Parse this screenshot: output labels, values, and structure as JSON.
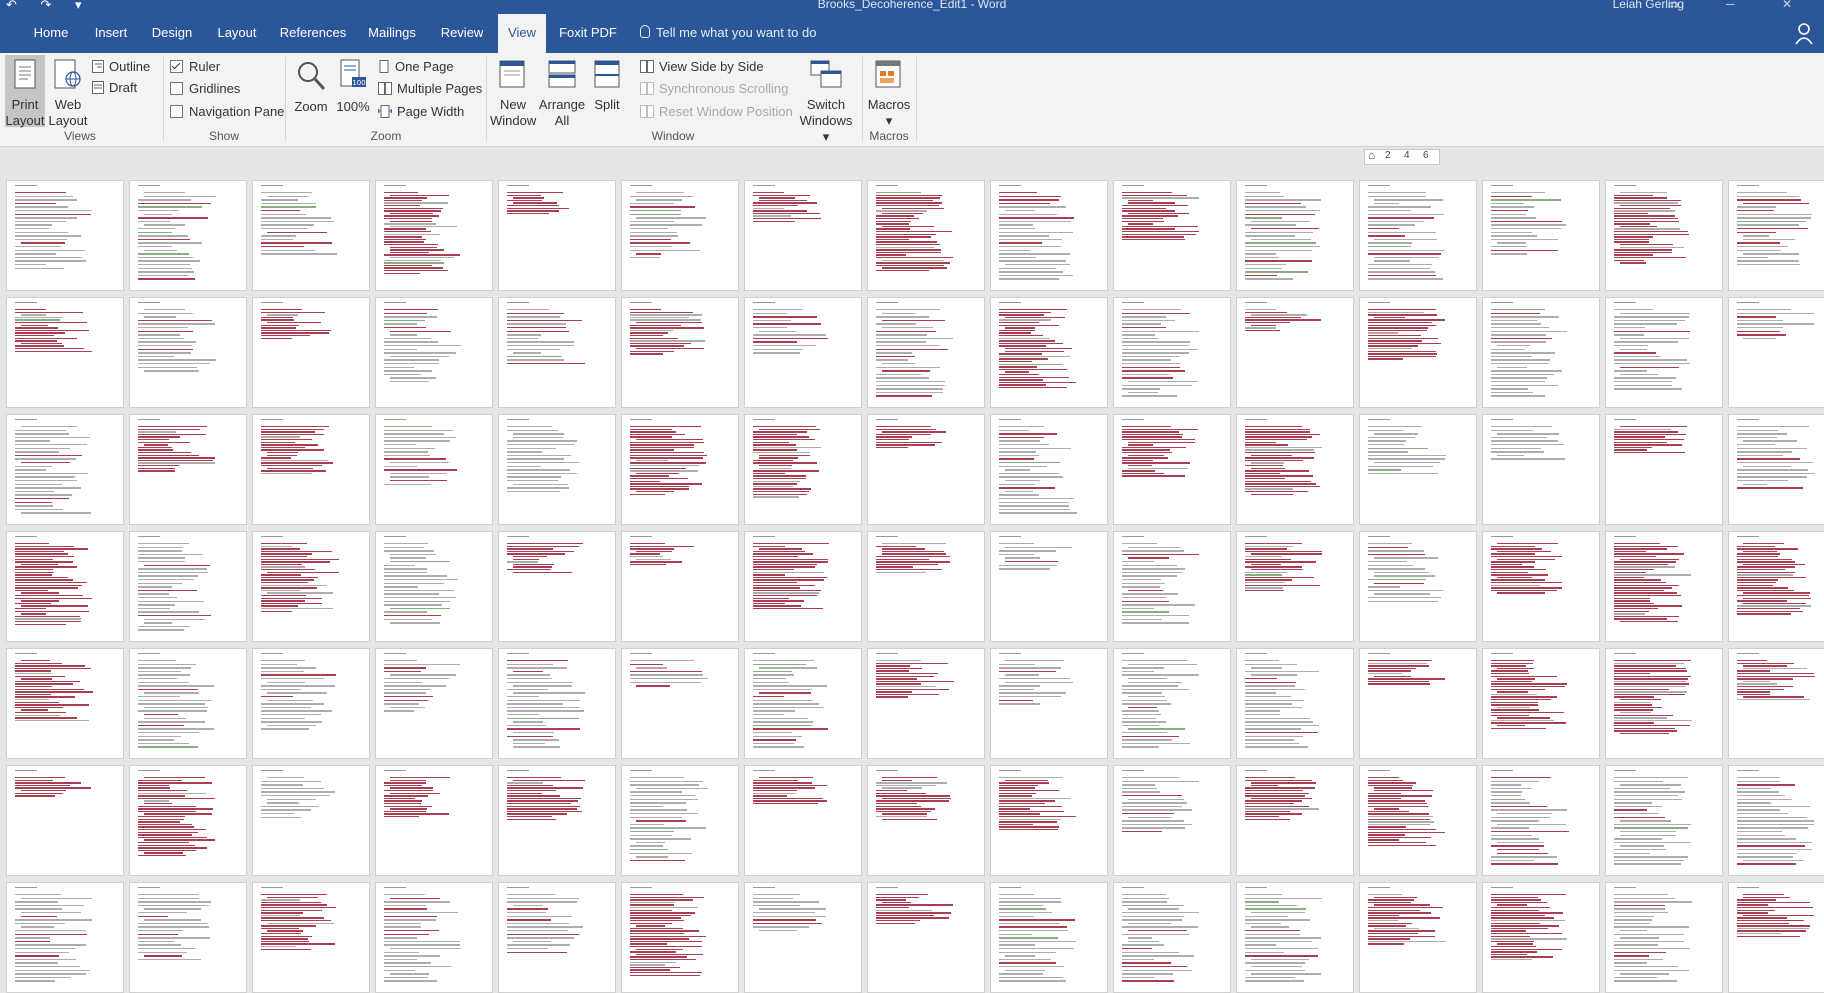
{
  "quick_access": {
    "undo_icon": "undo-icon",
    "redo_icon": "redo-icon",
    "customize_icon": "customize-qat-icon"
  },
  "window": {
    "title": "Brooks_Decoherence_Edit1 - Word",
    "user": "Leiah Gerling"
  },
  "tabs": [
    "Home",
    "Insert",
    "Design",
    "Layout",
    "References",
    "Mailings",
    "Review",
    "View",
    "Foxit PDF"
  ],
  "active_tab": "View",
  "tell_me": "Tell me what you want to do",
  "ribbon": {
    "views": {
      "label": "Views",
      "print_layout": [
        "Print",
        "Layout"
      ],
      "web_layout": [
        "Web",
        "Layout"
      ],
      "outline": "Outline",
      "draft": "Draft"
    },
    "show": {
      "label": "Show",
      "ruler": "Ruler",
      "ruler_checked": true,
      "gridlines": "Gridlines",
      "gridlines_checked": false,
      "navigation_pane": "Navigation Pane",
      "navigation_pane_checked": false
    },
    "zoom": {
      "label": "Zoom",
      "zoom": "Zoom",
      "hundred": "100%",
      "one_page": "One Page",
      "multiple_pages": "Multiple Pages",
      "page_width": "Page Width"
    },
    "window": {
      "label": "Window",
      "new_window": [
        "New",
        "Window"
      ],
      "arrange_all": [
        "Arrange",
        "All"
      ],
      "split": "Split",
      "side_by_side": "View Side by Side",
      "sync_scrolling": "Synchronous Scrolling",
      "reset_position": "Reset Window Position",
      "switch_windows": [
        "Switch",
        "Windows ▾"
      ]
    },
    "macros": {
      "label": "Macros",
      "macros": [
        "Macros",
        "▾"
      ]
    }
  },
  "ruler_ticks": [
    "2",
    "4",
    "6"
  ],
  "colors": {
    "word_blue": "#2b579a",
    "revision_red": "#9b1b30",
    "revision_green": "#3a7a2a"
  },
  "page_grid": {
    "rows": 7,
    "cols": 15,
    "note": ""
  }
}
